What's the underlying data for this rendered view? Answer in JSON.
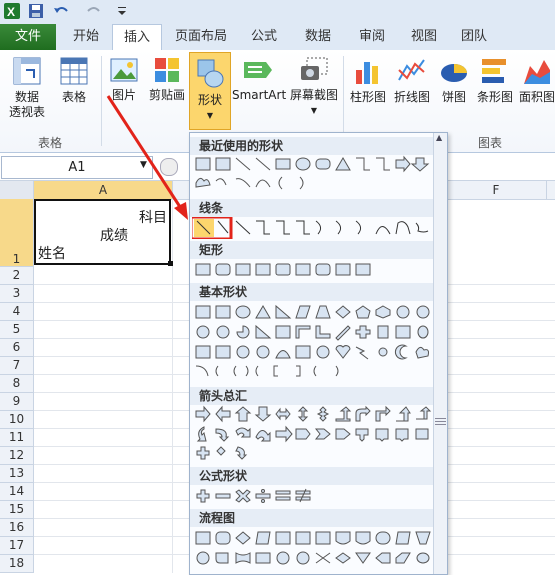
{
  "tabs": {
    "file": "文件",
    "home": "开始",
    "insert": "插入",
    "page_layout": "页面布局",
    "formulas": "公式",
    "data": "数据",
    "review": "审阅",
    "view": "视图",
    "team": "团队"
  },
  "ribbon": {
    "pivot_table_line1": "数据",
    "pivot_table_line2": "透视表",
    "table": "表格",
    "picture": "图片",
    "clip_art": "剪贴画",
    "shapes": "形状",
    "smartart": "SmartArt",
    "screenshot": "屏幕截图",
    "column_chart": "柱形图",
    "line_chart": "折线图",
    "pie_chart": "饼图",
    "bar_chart": "条形图",
    "area_chart": "面积图",
    "group_tables": "表格",
    "group_charts": "图表"
  },
  "formula_bar": {
    "name_box": "A1"
  },
  "sheet": {
    "col_a": "A",
    "col_f": "F",
    "cell_a1_line1": "科目",
    "cell_a1_line2": "成绩",
    "cell_a1_line3": "姓名",
    "rows": [
      "1",
      "2",
      "3",
      "4",
      "5",
      "6",
      "7",
      "8",
      "9",
      "10",
      "11",
      "12",
      "13",
      "14",
      "15",
      "16",
      "17",
      "18"
    ]
  },
  "shapes_menu": {
    "recent": "最近使用的形状",
    "lines": "线条",
    "rectangles": "矩形",
    "basic": "基本形状",
    "arrows": "箭头总汇",
    "equation": "公式形状",
    "flowchart": "流程图"
  },
  "colors": {
    "file_tab": "#1f6d1f",
    "highlight": "#e2231a",
    "selected_button": "#fcd66d"
  }
}
